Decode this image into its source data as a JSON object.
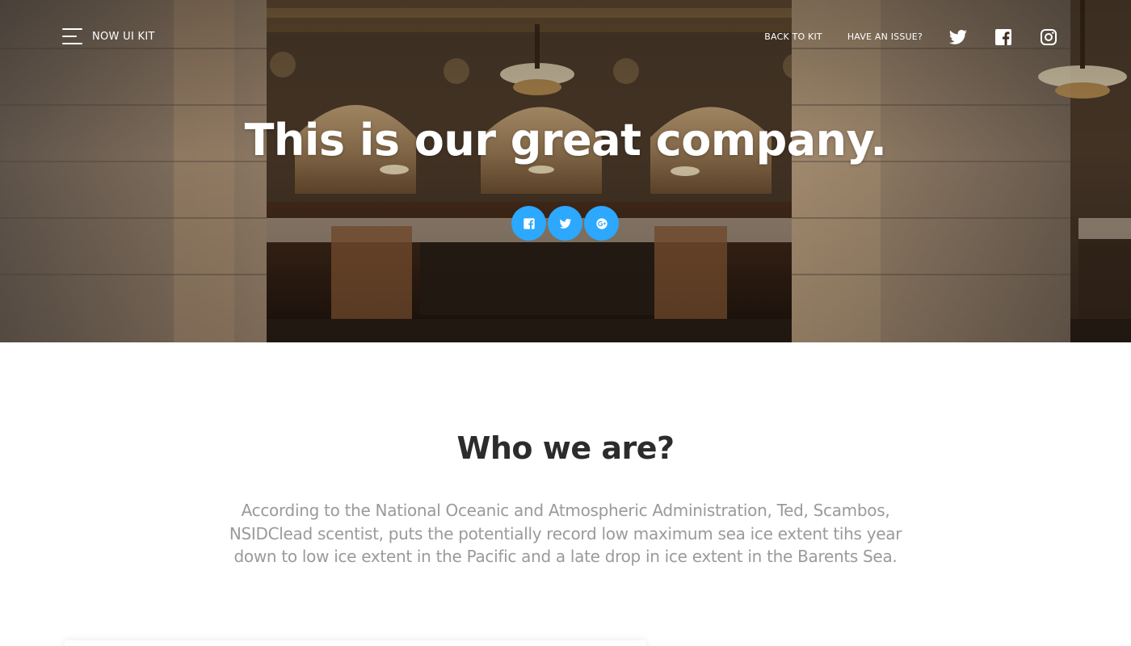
{
  "colors": {
    "accent": "#2CA8FF",
    "hero_text": "#ffffff",
    "title_text": "#2c2c2c",
    "body_text": "#9a9a9a"
  },
  "navbar": {
    "brand": "NOW UI KIT",
    "links": [
      "BACK TO KIT",
      "HAVE AN ISSUE?"
    ],
    "icons": [
      "twitter-icon",
      "facebook-icon",
      "instagram-icon"
    ]
  },
  "hero": {
    "title": "This is our great company.",
    "share_buttons": [
      "facebook-icon",
      "twitter-icon",
      "google-plus-icon"
    ]
  },
  "about": {
    "title": "Who we are?",
    "text": "According to the National Oceanic and Atmospheric Administration, Ted, Scambos, NSIDClead scentist, puts the potentially record low maximum sea ice extent tihs year down to low ice extent in the Pacific and a late drop in ice extent in the Barents Sea."
  }
}
